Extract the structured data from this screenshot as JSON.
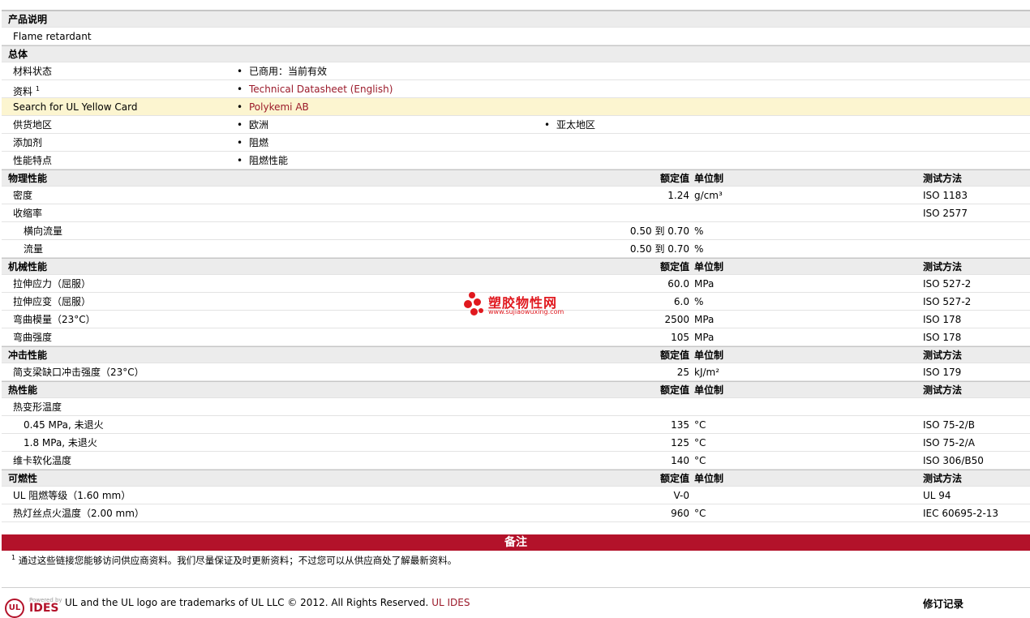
{
  "sections": {
    "desc_title": "产品说明",
    "desc_text": "Flame retardant",
    "general_title": "总体",
    "physical_title": "物理性能",
    "mechanical_title": "机械性能",
    "impact_title": "冲击性能",
    "thermal_title": "热性能",
    "flammability_title": "可燃性"
  },
  "headers": {
    "nominal": "额定值",
    "unit": "单位制",
    "method": "测试方法"
  },
  "general": {
    "status_label": "材料状态",
    "status_value": "已商用：当前有效",
    "doc_label": "资料",
    "doc_sup": "1",
    "doc_value": "Technical Datasheet (English)",
    "ul_label": "Search for UL Yellow Card",
    "ul_value": "Polykemi AB",
    "region_label": "供货地区",
    "region_1": "欧洲",
    "region_2": "亚太地区",
    "additive_label": "添加剂",
    "additive_value": "阻燃",
    "feature_label": "性能特点",
    "feature_value": "阻燃性能"
  },
  "physical": [
    {
      "label": "密度",
      "value": "1.24",
      "unit": "g/cm³",
      "method": "ISO 1183"
    },
    {
      "label": "收缩率",
      "value": "",
      "unit": "",
      "method": "ISO 2577"
    },
    {
      "label": "横向流量",
      "value": "0.50 到  0.70",
      "unit": "%",
      "method": ""
    },
    {
      "label": "流量",
      "value": "0.50 到  0.70",
      "unit": "%",
      "method": ""
    }
  ],
  "mechanical": [
    {
      "label": "拉伸应力（屈服）",
      "value": "60.0",
      "unit": "MPa",
      "method": "ISO 527-2"
    },
    {
      "label": "拉伸应变（屈服）",
      "value": "6.0",
      "unit": "%",
      "method": "ISO 527-2"
    },
    {
      "label": "弯曲模量（23°C）",
      "value": "2500",
      "unit": "MPa",
      "method": "ISO 178"
    },
    {
      "label": "弯曲强度",
      "value": "105",
      "unit": "MPa",
      "method": "ISO 178"
    }
  ],
  "impact": [
    {
      "label": "简支梁缺口冲击强度（23°C）",
      "value": "25",
      "unit": "kJ/m²",
      "method": "ISO 179"
    }
  ],
  "thermal": [
    {
      "label": "热变形温度",
      "value": "",
      "unit": "",
      "method": ""
    },
    {
      "label": "0.45 MPa, 未退火",
      "value": "135",
      "unit": "°C",
      "method": "ISO 75-2/B"
    },
    {
      "label": "1.8 MPa, 未退火",
      "value": "125",
      "unit": "°C",
      "method": "ISO 75-2/A"
    },
    {
      "label": "维卡软化温度",
      "value": "140",
      "unit": "°C",
      "method": "ISO 306/B50"
    }
  ],
  "flammability": [
    {
      "label": "UL 阻燃等级（1.60 mm）",
      "value": "V-0",
      "unit": "",
      "method": "UL 94"
    },
    {
      "label": "热灯丝点火温度（2.00 mm）",
      "value": "960",
      "unit": "°C",
      "method": "IEC 60695-2-13"
    }
  ],
  "notes": {
    "title": "备注",
    "sup": "1",
    "text": "通过这些链接您能够访问供应商资料。我们尽量保证及时更新资料；不过您可以从供应商处了解最新资料。"
  },
  "footer": {
    "powered": "Powered by",
    "ides_logo": "IDES",
    "ul_logo": "UL",
    "trademark": "UL and the UL logo are trademarks of UL LLC © 2012. All Rights Reserved.",
    "ul_ides_link": "UL IDES",
    "revision": "修订记录"
  },
  "watermark": {
    "name": "塑胶物性网",
    "url": "www.sujiaowuxing.com"
  },
  "colors": {
    "accent": "#b3122a",
    "link": "#9b1a2a",
    "section_bg": "#ececec",
    "highlight": "#fcf5d0"
  }
}
